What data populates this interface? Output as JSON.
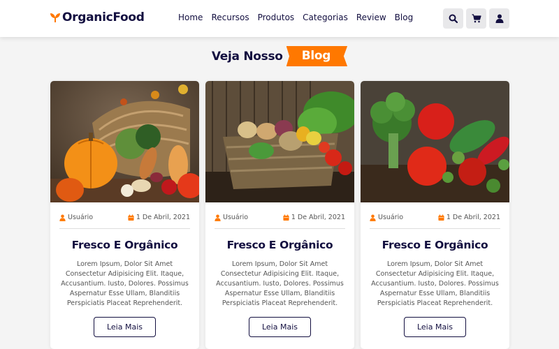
{
  "header": {
    "logo_text": "OrganicFood",
    "nav": [
      "Home",
      "Recursos",
      "Produtos",
      "Categorias",
      "Review",
      "Blog"
    ],
    "icons": [
      "search-icon",
      "cart-icon",
      "user-icon"
    ]
  },
  "section": {
    "heading_main": "Veja Nosso",
    "heading_accent": "Blog"
  },
  "cards": [
    {
      "image": "autumn-vegetables-basket-image",
      "author": "Usuário",
      "date": "1 De Abril, 2021",
      "title": "Fresco E Orgânico",
      "text": "Lorem Ipsum, Dolor Sit Amet Consectetur Adipisicing Elit. Itaque, Accusantium. Iusto, Dolores. Possimus Aspernatur Esse Ullam, Blanditiis Perspiciatis Placeat Reprehenderit.",
      "button": "Leia Mais"
    },
    {
      "image": "vegetable-basket-image",
      "author": "Usuário",
      "date": "1 De Abril, 2021",
      "title": "Fresco E Orgânico",
      "text": "Lorem Ipsum, Dolor Sit Amet Consectetur Adipisicing Elit. Itaque, Accusantium. Iusto, Dolores. Possimus Aspernatur Esse Ullam, Blanditiis Perspiciatis Placeat Reprehenderit.",
      "button": "Leia Mais"
    },
    {
      "image": "broccoli-tomatoes-image",
      "author": "Usuário",
      "date": "1 De Abril, 2021",
      "title": "Fresco E Orgânico",
      "text": "Lorem Ipsum, Dolor Sit Amet Consectetur Adipisicing Elit. Itaque, Accusantium. Iusto, Dolores. Possimus Aspernatur Esse Ullam, Blanditiis Perspiciatis Placeat Reprehenderit.",
      "button": "Leia Mais"
    }
  ],
  "colors": {
    "accent": "#ff7800",
    "text_dark": "#130f40",
    "background": "#f4f4f4"
  }
}
